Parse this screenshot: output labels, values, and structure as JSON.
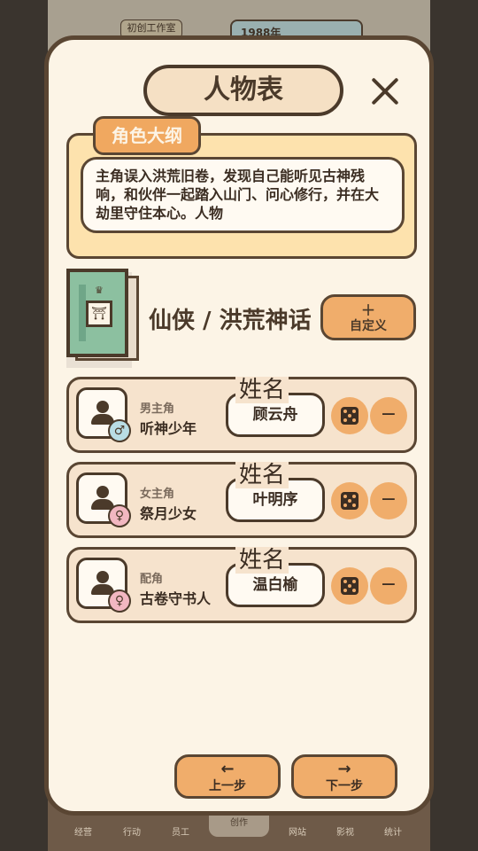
{
  "background": {
    "studio": "初创工作室",
    "year": "1988年",
    "nav": [
      "经营",
      "行动",
      "员工",
      "创作",
      "网站",
      "影视",
      "统计"
    ]
  },
  "modal": {
    "title": "人物表",
    "outline_tab": "角色大纲",
    "outline_text": "主角误入洪荒旧卷，发现自己能听见古神残响，和伙伴一起踏入山门、问心修行，并在大劫里守住本心。人物",
    "genre": "仙侠 / 洪荒神话",
    "custom_plus": "+",
    "custom_label": "自定义",
    "name_label": "姓名",
    "characters": [
      {
        "role": "男主角",
        "archetype": "听神少年",
        "name": "顾云舟",
        "gender": "♂",
        "gender_icon": "male-icon"
      },
      {
        "role": "女主角",
        "archetype": "祭月少女",
        "name": "叶明序",
        "gender": "♀",
        "gender_icon": "female-icon"
      },
      {
        "role": "配角",
        "archetype": "古卷守书人",
        "name": "温白榆",
        "gender": "♀",
        "gender_icon": "female-icon"
      }
    ],
    "prev_arrow": "←",
    "prev_label": "上一步",
    "next_arrow": "→",
    "next_label": "下一步"
  },
  "colors": {
    "panel": "#fcf4e6",
    "accent": "#f0ad6b",
    "outline": "#5a4633",
    "male": "#b9dde4",
    "female": "#f2b7c1"
  }
}
